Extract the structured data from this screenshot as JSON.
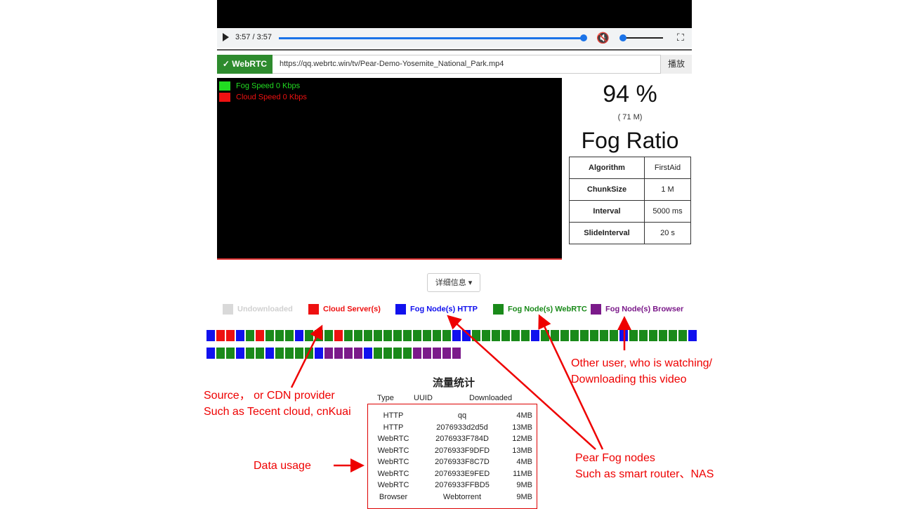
{
  "player": {
    "time": "3:57 / 3:57",
    "progress_fraction": 1.0,
    "volume_fraction": 0.0,
    "play_icon": "play-icon",
    "mute_icon": "volume-muted-icon",
    "fullscreen_icon": "fullscreen-icon"
  },
  "urlbar": {
    "webrtc_label": "✓ WebRTC",
    "url": "https://qq.webrtc.win/tv/Pear-Demo-Yosemite_National_Park.mp4",
    "play_label": "播放"
  },
  "speed_legend": {
    "fog": "Fog Speed 0 Kbps",
    "cloud": "Cloud Speed 0 Kbps",
    "fog_color": "#22dd22",
    "cloud_color": "#ee1111"
  },
  "ratio": {
    "percent": "94 %",
    "size": "( 71 M)",
    "title": "Fog Ratio"
  },
  "params": [
    {
      "key": "Algorithm",
      "value": "FirstAid"
    },
    {
      "key": "ChunkSize",
      "value": "1 M"
    },
    {
      "key": "Interval",
      "value": "5000 ms"
    },
    {
      "key": "SlideInterval",
      "value": "20 s"
    }
  ],
  "details_button": "详细信息",
  "chunk_legend": [
    {
      "label": "Undownloaded",
      "color": "#d9d9d9"
    },
    {
      "label": "Cloud Server(s)",
      "color": "#ee1111"
    },
    {
      "label": "Fog Node(s) HTTP",
      "color": "#1111ee"
    },
    {
      "label": "Fog Node(s) WebRTC",
      "color": "#1a8a1a"
    },
    {
      "label": "Fog Node(s) Browser",
      "color": "#7b1a8a"
    }
  ],
  "chunks": [
    "B",
    "R",
    "R",
    "B",
    "G",
    "R",
    "G",
    "G",
    "G",
    "B",
    "G",
    "G",
    "G",
    "R",
    "G",
    "G",
    "G",
    "G",
    "G",
    "G",
    "G",
    "G",
    "G",
    "G",
    "G",
    "B",
    "B",
    "G",
    "G",
    "G",
    "G",
    "G",
    "G",
    "B",
    "G",
    "G",
    "G",
    "G",
    "G",
    "G",
    "G",
    "G",
    "B",
    "G",
    "G",
    "G",
    "G",
    "G",
    "G",
    "B",
    "B",
    "G",
    "G",
    "B",
    "G",
    "G",
    "B",
    "G",
    "G",
    "G",
    "G",
    "B",
    "P",
    "P",
    "P",
    "P",
    "B",
    "G",
    "G",
    "G",
    "G",
    "P",
    "P",
    "P",
    "P",
    "P"
  ],
  "stats": {
    "title": "流量统计",
    "headers": [
      "Type",
      "UUID",
      "Downloaded"
    ],
    "rows": [
      [
        "HTTP",
        "qq",
        "4MB"
      ],
      [
        "HTTP",
        "2076933d2d5d",
        "13MB"
      ],
      [
        "WebRTC",
        "2076933F784D",
        "12MB"
      ],
      [
        "WebRTC",
        "2076933F9DFD",
        "13MB"
      ],
      [
        "WebRTC",
        "2076933F8C7D",
        "4MB"
      ],
      [
        "WebRTC",
        "2076933E9FED",
        "11MB"
      ],
      [
        "WebRTC",
        "2076933FFBD5",
        "9MB"
      ],
      [
        "Browser",
        "Webtorrent",
        "9MB"
      ]
    ]
  },
  "annotations": {
    "source_line1": "Source， or CDN provider",
    "source_line2": "Such as Tecent cloud, cnKuai",
    "data_usage": "Data usage",
    "fog_line1": "Pear Fog nodes",
    "fog_line2": "Such as smart router、NAS",
    "user_line1": "Other user, who is watching/",
    "user_line2": "Downloading this video",
    "color": "#ee0000"
  }
}
